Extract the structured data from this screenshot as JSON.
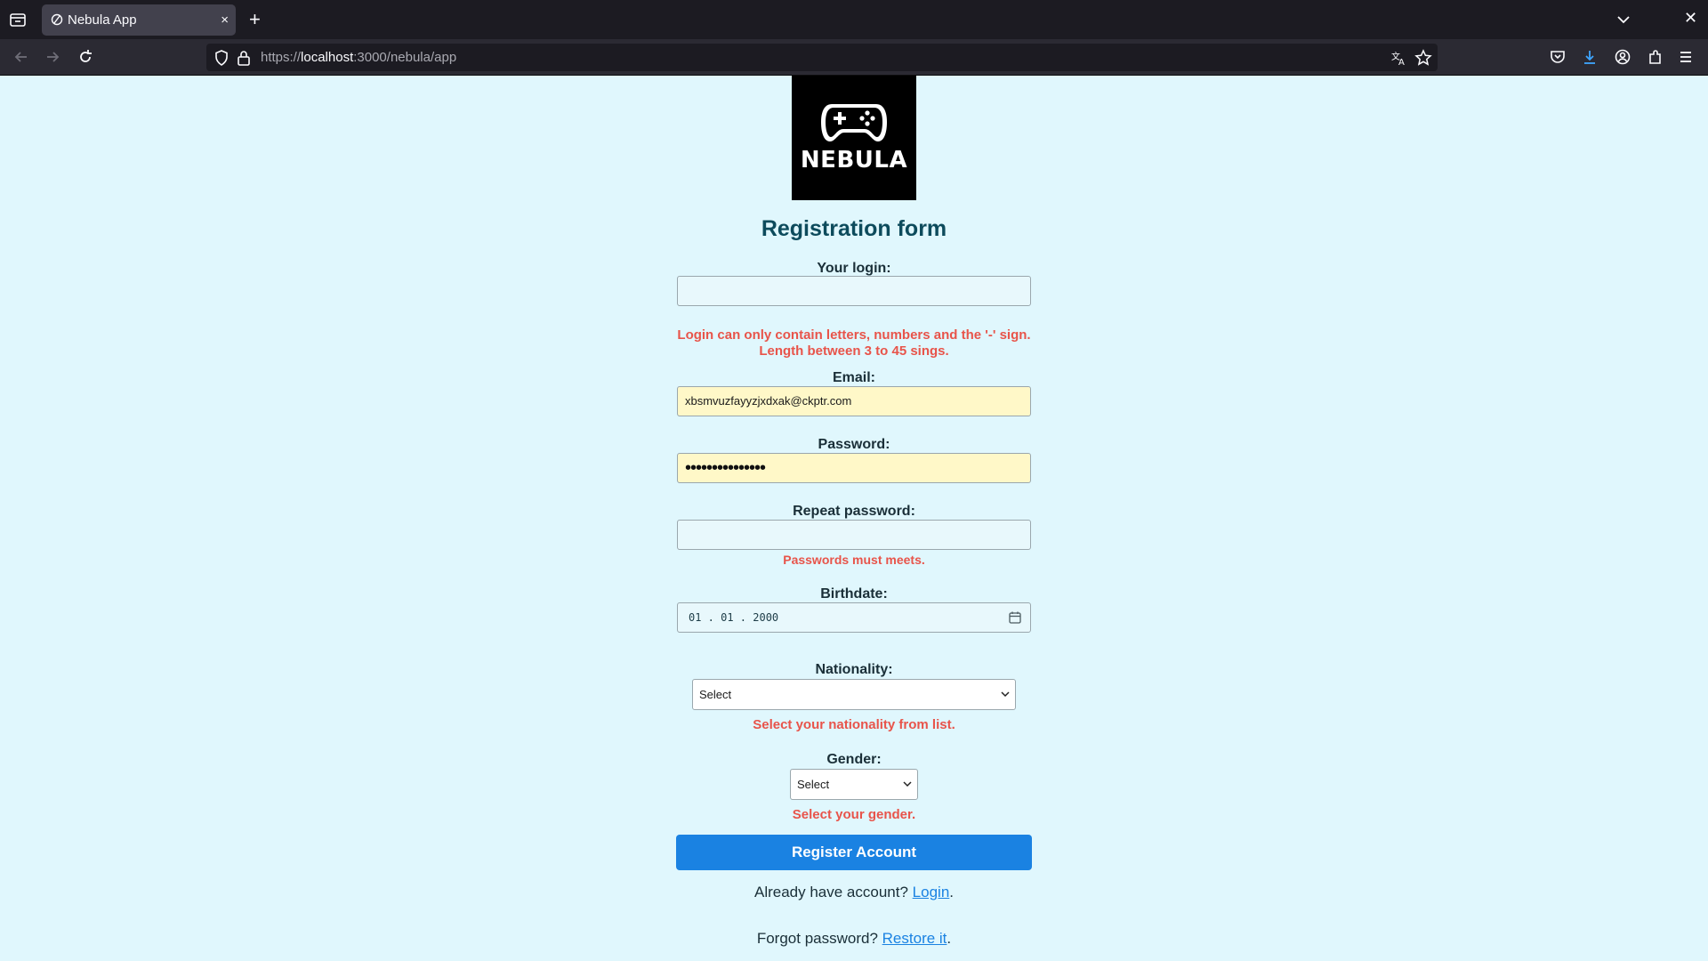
{
  "browser": {
    "tab_title": "Nebula App",
    "tab_close": "×",
    "new_tab": "+",
    "window_close": "✕",
    "url_scheme": "https://",
    "url_host": "localhost",
    "url_path": ":3000/nebula/app"
  },
  "logo": {
    "text": "NEBULA"
  },
  "form": {
    "title": "Registration form",
    "login": {
      "label": "Your login:",
      "value": "",
      "error_line1": "Login can only contain letters, numbers and the '-' sign.",
      "error_line2": "Length between 3 to 45 sings."
    },
    "email": {
      "label": "Email:",
      "value": "xbsmvuzfayyzjxdxak@ckptr.com"
    },
    "password": {
      "label": "Password:",
      "value": "•••••••••••••••"
    },
    "repeat_password": {
      "label": "Repeat password:",
      "value": "",
      "error": "Passwords must meets."
    },
    "birthdate": {
      "label": "Birthdate:",
      "value": "01 . 01 . 2000"
    },
    "nationality": {
      "label": "Nationality:",
      "selected": "Select",
      "error": "Select your nationality from list."
    },
    "gender": {
      "label": "Gender:",
      "selected": "Select",
      "error": "Select your gender."
    },
    "submit_label": "Register Account"
  },
  "footer": {
    "have_account_text": "Already have account?",
    "login_link": "Login",
    "forgot_text": "Forgot password?",
    "restore_link": "Restore it",
    "period": "."
  },
  "colors": {
    "page_bg": "#e0f7fd",
    "accent": "#1a82e2",
    "error": "#e8544a",
    "heading": "#0d4b5c"
  }
}
